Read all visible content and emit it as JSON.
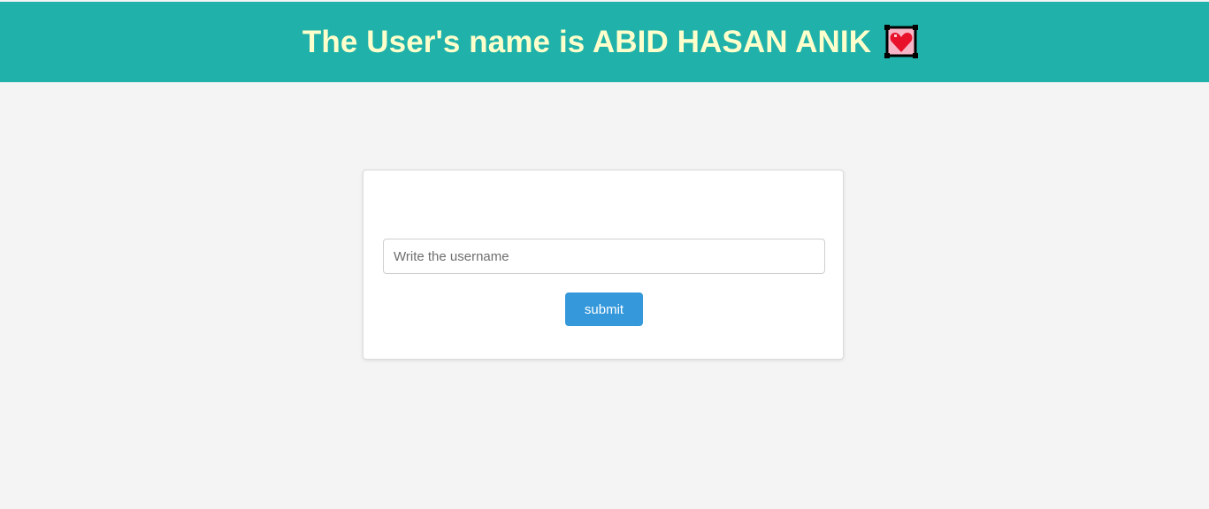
{
  "header": {
    "title": "The User's name is ABID HASAN ANIK",
    "icon": "heart-emoji-icon",
    "background_color": "#20b2aa",
    "title_color": "#ffffcc"
  },
  "form": {
    "username_input": {
      "value": "",
      "placeholder": "Write the username"
    },
    "submit_label": "submit",
    "submit_color": "#3498db"
  },
  "page": {
    "background_color": "#f4f4f4"
  }
}
